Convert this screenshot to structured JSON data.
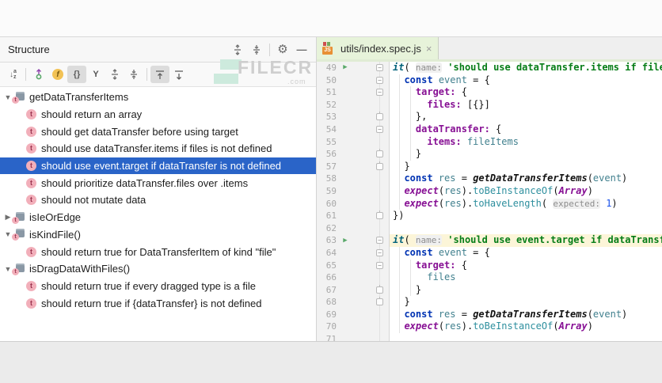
{
  "watermark": {
    "text": "FILECR",
    "suffix": ".com"
  },
  "icons": {
    "gear": "⚙",
    "minimize": "—",
    "close": "×",
    "chevron_down": "▼",
    "chevron_right": "▶",
    "run": "▶",
    "test_badge": "t",
    "fields_glyph": "f",
    "braces_glyph": "{}",
    "merge_glyph": "Y",
    "sort_a": "a",
    "sort_z": "z",
    "js_label": "JS"
  },
  "colors": {
    "selection_blue": "#2a64c8",
    "tab_test_green": "#e7f3da",
    "line_highlight_yellow": "#fcf5d8",
    "run_green": "#59a869",
    "string_green": "#067d17",
    "keyword_blue": "#0033b3",
    "property_purple": "#871094"
  },
  "structure": {
    "title": "Structure",
    "tree": [
      {
        "depth": 0,
        "kind": "suite",
        "state": "expanded",
        "selected": false,
        "label": "getDataTransferItems"
      },
      {
        "depth": 1,
        "kind": "test",
        "state": null,
        "selected": false,
        "label": "should return an array"
      },
      {
        "depth": 1,
        "kind": "test",
        "state": null,
        "selected": false,
        "label": "should get dataTransfer before using target"
      },
      {
        "depth": 1,
        "kind": "test",
        "state": null,
        "selected": false,
        "label": "should use dataTransfer.items if files is not defined"
      },
      {
        "depth": 1,
        "kind": "test",
        "state": null,
        "selected": true,
        "label": "should use event.target if dataTransfer is not defined"
      },
      {
        "depth": 1,
        "kind": "test",
        "state": null,
        "selected": false,
        "label": "should prioritize dataTransfer.files over .items"
      },
      {
        "depth": 1,
        "kind": "test",
        "state": null,
        "selected": false,
        "label": "should not mutate data"
      },
      {
        "depth": 0,
        "kind": "suite",
        "state": "collapsed",
        "selected": false,
        "label": "isIeOrEdge"
      },
      {
        "depth": 0,
        "kind": "suite",
        "state": "expanded",
        "selected": false,
        "label": "isKindFile()"
      },
      {
        "depth": 1,
        "kind": "test",
        "state": null,
        "selected": false,
        "label": "should return true for DataTransferItem of kind \"file\""
      },
      {
        "depth": 0,
        "kind": "suite",
        "state": "expanded",
        "selected": false,
        "label": "isDragDataWithFiles()"
      },
      {
        "depth": 1,
        "kind": "test",
        "state": null,
        "selected": false,
        "label": "should return true if every dragged type is a file"
      },
      {
        "depth": 1,
        "kind": "test",
        "state": null,
        "selected": false,
        "label": "should return true if {dataTransfer} is not defined"
      }
    ]
  },
  "editor": {
    "tab": {
      "label": "utils/index.spec.js"
    },
    "lines": [
      {
        "n": 49,
        "run": true,
        "fold": "start",
        "hl": false,
        "tokens": [
          [
            "fnlib",
            "it"
          ],
          [
            "pln",
            "( "
          ],
          [
            "hint",
            "name:"
          ],
          [
            "pln",
            " "
          ],
          [
            "str",
            "'should use dataTransfer.items if files is"
          ]
        ]
      },
      {
        "n": 50,
        "run": false,
        "fold": "start",
        "hl": false,
        "tokens": [
          [
            "pln",
            "  "
          ],
          [
            "kw",
            "const"
          ],
          [
            "pln",
            " "
          ],
          [
            "vr",
            "event"
          ],
          [
            "pln",
            " = {"
          ]
        ]
      },
      {
        "n": 51,
        "run": false,
        "fold": "start",
        "hl": false,
        "tokens": [
          [
            "pln",
            "    "
          ],
          [
            "prop",
            "target:"
          ],
          [
            "pln",
            " {"
          ]
        ]
      },
      {
        "n": 52,
        "run": false,
        "fold": null,
        "hl": false,
        "tokens": [
          [
            "pln",
            "      "
          ],
          [
            "prop",
            "files:"
          ],
          [
            "pln",
            " [{}]"
          ]
        ]
      },
      {
        "n": 53,
        "run": false,
        "fold": "end",
        "hl": false,
        "tokens": [
          [
            "pln",
            "    },"
          ]
        ]
      },
      {
        "n": 54,
        "run": false,
        "fold": "start",
        "hl": false,
        "tokens": [
          [
            "pln",
            "    "
          ],
          [
            "prop",
            "dataTransfer:"
          ],
          [
            "pln",
            " {"
          ]
        ]
      },
      {
        "n": 55,
        "run": false,
        "fold": null,
        "hl": false,
        "tokens": [
          [
            "pln",
            "      "
          ],
          [
            "prop",
            "items:"
          ],
          [
            "pln",
            " "
          ],
          [
            "vr",
            "fileItems"
          ]
        ]
      },
      {
        "n": 56,
        "run": false,
        "fold": "end",
        "hl": false,
        "tokens": [
          [
            "pln",
            "    }"
          ]
        ]
      },
      {
        "n": 57,
        "run": false,
        "fold": "end",
        "hl": false,
        "tokens": [
          [
            "pln",
            "  }"
          ]
        ]
      },
      {
        "n": 58,
        "run": false,
        "fold": null,
        "hl": false,
        "tokens": [
          [
            "pln",
            "  "
          ],
          [
            "kw",
            "const"
          ],
          [
            "pln",
            " "
          ],
          [
            "vr",
            "res"
          ],
          [
            "pln",
            " = "
          ],
          [
            "fncall",
            "getDataTransferItems"
          ],
          [
            "pln",
            "("
          ],
          [
            "vr",
            "event"
          ],
          [
            "pln",
            ")"
          ]
        ]
      },
      {
        "n": 59,
        "run": false,
        "fold": null,
        "hl": false,
        "tokens": [
          [
            "pln",
            "  "
          ],
          [
            "fnexp",
            "expect"
          ],
          [
            "pln",
            "("
          ],
          [
            "vr",
            "res"
          ],
          [
            "pln",
            ")."
          ],
          [
            "mth",
            "toBeInstanceOf"
          ],
          [
            "pln",
            "("
          ],
          [
            "cls",
            "Array"
          ],
          [
            "pln",
            ")"
          ]
        ]
      },
      {
        "n": 60,
        "run": false,
        "fold": null,
        "hl": false,
        "tokens": [
          [
            "pln",
            "  "
          ],
          [
            "fnexp",
            "expect"
          ],
          [
            "pln",
            "("
          ],
          [
            "vr",
            "res"
          ],
          [
            "pln",
            ")."
          ],
          [
            "mth",
            "toHaveLength"
          ],
          [
            "pln",
            "( "
          ],
          [
            "hint",
            "expected:"
          ],
          [
            "pln",
            " "
          ],
          [
            "num",
            "1"
          ],
          [
            "pln",
            ")"
          ]
        ]
      },
      {
        "n": 61,
        "run": false,
        "fold": "end",
        "hl": false,
        "tokens": [
          [
            "pln",
            "})"
          ]
        ]
      },
      {
        "n": 62,
        "run": false,
        "fold": null,
        "hl": false,
        "tokens": []
      },
      {
        "n": 63,
        "run": true,
        "fold": "start",
        "hl": true,
        "tokens": [
          [
            "fnlib",
            "it"
          ],
          [
            "pln",
            "( "
          ],
          [
            "hint",
            "name:"
          ],
          [
            "pln",
            " "
          ],
          [
            "str",
            "'should use event.target if dataTransfer"
          ]
        ]
      },
      {
        "n": 64,
        "run": false,
        "fold": "start",
        "hl": false,
        "tokens": [
          [
            "pln",
            "  "
          ],
          [
            "kw",
            "const"
          ],
          [
            "pln",
            " "
          ],
          [
            "vr",
            "event"
          ],
          [
            "pln",
            " = {"
          ]
        ]
      },
      {
        "n": 65,
        "run": false,
        "fold": "start",
        "hl": false,
        "tokens": [
          [
            "pln",
            "    "
          ],
          [
            "prop",
            "target:"
          ],
          [
            "pln",
            " {"
          ]
        ]
      },
      {
        "n": 66,
        "run": false,
        "fold": null,
        "hl": false,
        "tokens": [
          [
            "pln",
            "      "
          ],
          [
            "vr",
            "files"
          ]
        ]
      },
      {
        "n": 67,
        "run": false,
        "fold": "end",
        "hl": false,
        "tokens": [
          [
            "pln",
            "    }"
          ]
        ]
      },
      {
        "n": 68,
        "run": false,
        "fold": "end",
        "hl": false,
        "tokens": [
          [
            "pln",
            "  }"
          ]
        ]
      },
      {
        "n": 69,
        "run": false,
        "fold": null,
        "hl": false,
        "tokens": [
          [
            "pln",
            "  "
          ],
          [
            "kw",
            "const"
          ],
          [
            "pln",
            " "
          ],
          [
            "vr",
            "res"
          ],
          [
            "pln",
            " = "
          ],
          [
            "fncall",
            "getDataTransferItems"
          ],
          [
            "pln",
            "("
          ],
          [
            "vr",
            "event"
          ],
          [
            "pln",
            ")"
          ]
        ]
      },
      {
        "n": 70,
        "run": false,
        "fold": null,
        "hl": false,
        "tokens": [
          [
            "pln",
            "  "
          ],
          [
            "fnexp",
            "expect"
          ],
          [
            "pln",
            "("
          ],
          [
            "vr",
            "res"
          ],
          [
            "pln",
            ")."
          ],
          [
            "mth",
            "toBeInstanceOf"
          ],
          [
            "pln",
            "("
          ],
          [
            "cls",
            "Array"
          ],
          [
            "pln",
            ")"
          ]
        ]
      },
      {
        "n": 71,
        "run": false,
        "fold": null,
        "hl": false,
        "tokens": []
      }
    ]
  }
}
